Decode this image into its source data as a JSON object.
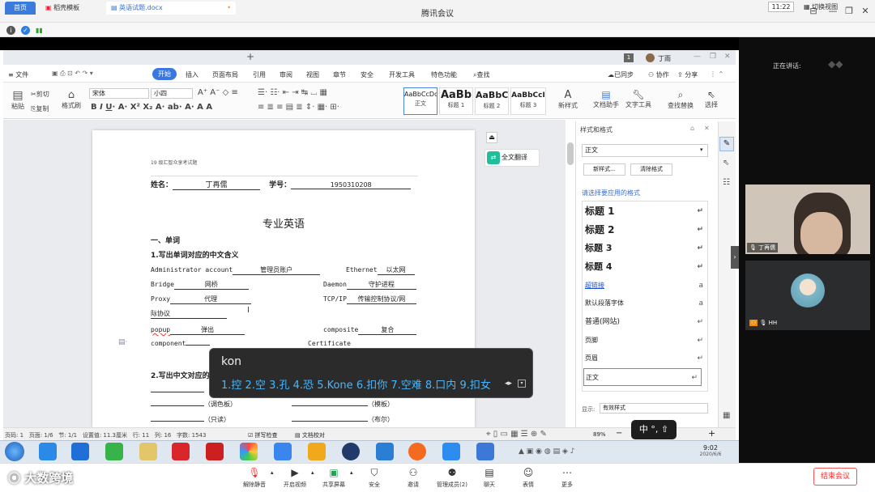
{
  "app": {
    "title": "腾讯会议",
    "meeting_time": "11:22",
    "switch_view": "切换视图"
  },
  "wps": {
    "tabs": {
      "home": "首页",
      "template": "稻壳模板",
      "document": "英语试题.docx"
    },
    "user": "丁雨",
    "page_badge": "1",
    "menu": {
      "file": "文件",
      "items": [
        "开始",
        "插入",
        "页面布局",
        "引用",
        "审阅",
        "视图",
        "章节",
        "安全",
        "开发工具",
        "特色功能"
      ],
      "search": "查找",
      "sync": "已同步",
      "collab": "协作",
      "share": "分享"
    },
    "ribbon": {
      "paste": "粘贴",
      "cut": "剪切",
      "copy": "复制",
      "format_painter": "格式刷",
      "font_name": "宋体",
      "font_size": "小四",
      "styles": [
        {
          "sample": "AaBbCcDd",
          "name": "正文"
        },
        {
          "sample": "AaBb",
          "name": "标题 1"
        },
        {
          "sample": "AaBbC",
          "name": "标题 2"
        },
        {
          "sample": "AaBbCcI",
          "name": "标题 3"
        }
      ],
      "new_style": "新样式",
      "doc_assistant": "文档助手",
      "text_tools": "文字工具",
      "find_replace": "查找替换",
      "select": "选择"
    },
    "document": {
      "header": "19 级汇智众享考试题",
      "name_label": "姓名：",
      "name_value": "丁再儒",
      "id_label": "学号：",
      "id_value": "1950310208",
      "title": "专业英语",
      "section1": "一、单词",
      "subsection1": "1.写出单词对应的中文含义",
      "rows": [
        {
          "left_en": "Administrator account",
          "left_zh": "管理员账户",
          "right_en": "Ethernet",
          "right_zh": "以太网"
        },
        {
          "left_en": "Bridge",
          "left_zh": "网桥",
          "right_en": "Daemon",
          "right_zh": "守护进程"
        },
        {
          "left_en": "Proxy",
          "left_zh": "代理",
          "right_en": "TCP/IP",
          "right_zh": "传输控制协议/网"
        },
        {
          "left_en": "",
          "left_zh": "际协议",
          "right_en": "",
          "right_zh": ""
        },
        {
          "left_en": "popup",
          "left_zh": "弹出",
          "right_en": "composite",
          "right_zh": "复合"
        },
        {
          "left_en": "component",
          "left_zh": "",
          "right_en": "Certificate",
          "right_zh": ""
        }
      ],
      "subsection2": "2.写出中文对应的",
      "rows2": [
        {
          "left": "（调色板）",
          "right": "（模板）"
        },
        {
          "left": "（只读）",
          "right": "（布尔）"
        }
      ],
      "translate_button": "全文翻译"
    },
    "style_panel": {
      "title": "样式和格式",
      "current": "正文",
      "new_style": "新样式...",
      "clear_format": "清除格式",
      "prompt": "请选择要应用的格式",
      "items": [
        "标题 1",
        "标题 2",
        "标题 3",
        "标题 4",
        "超链接",
        "默认段落字体",
        "普通(网站)",
        "页脚",
        "页眉",
        "正文"
      ],
      "show_label": "显示:",
      "show_value": "有效样式"
    },
    "status": {
      "page_num": "页码: 1",
      "pages": "页面: 1/6",
      "section": "节: 1/1",
      "set_value": "设置值: 11.3厘米",
      "row": "行: 11",
      "col": "列: 16",
      "word_count": "字数: 1543",
      "spell": "拼写检查",
      "proof": "文档校对",
      "zoom": "89%"
    }
  },
  "ime": {
    "input": "kon",
    "candidates": [
      "1.控",
      "2.空",
      "3.孔",
      "4.恐",
      "5.Kone",
      "6.扣你",
      "7.空难",
      "8.口内",
      "9.扣女"
    ],
    "mode": "中 °, ⇧"
  },
  "taskbar": {
    "time": "9:02",
    "date": "2020/6/6"
  },
  "participants": {
    "speaking_label": "正在讲话:",
    "user1": "丁再儒",
    "user2": "HH"
  },
  "bottombar": {
    "buttons": [
      "解除静音",
      "开启视频",
      "共享屏幕",
      "安全",
      "邀请",
      "管理成员(2)",
      "聊天",
      "表情",
      "更多"
    ],
    "end_meeting": "结束会议"
  },
  "watermark": "大数跨境",
  "colors": {
    "accent": "#3a78e0",
    "share_border": "#19d05d",
    "ime_candidates": "#46b7ff",
    "end_meeting": "#e33333"
  }
}
